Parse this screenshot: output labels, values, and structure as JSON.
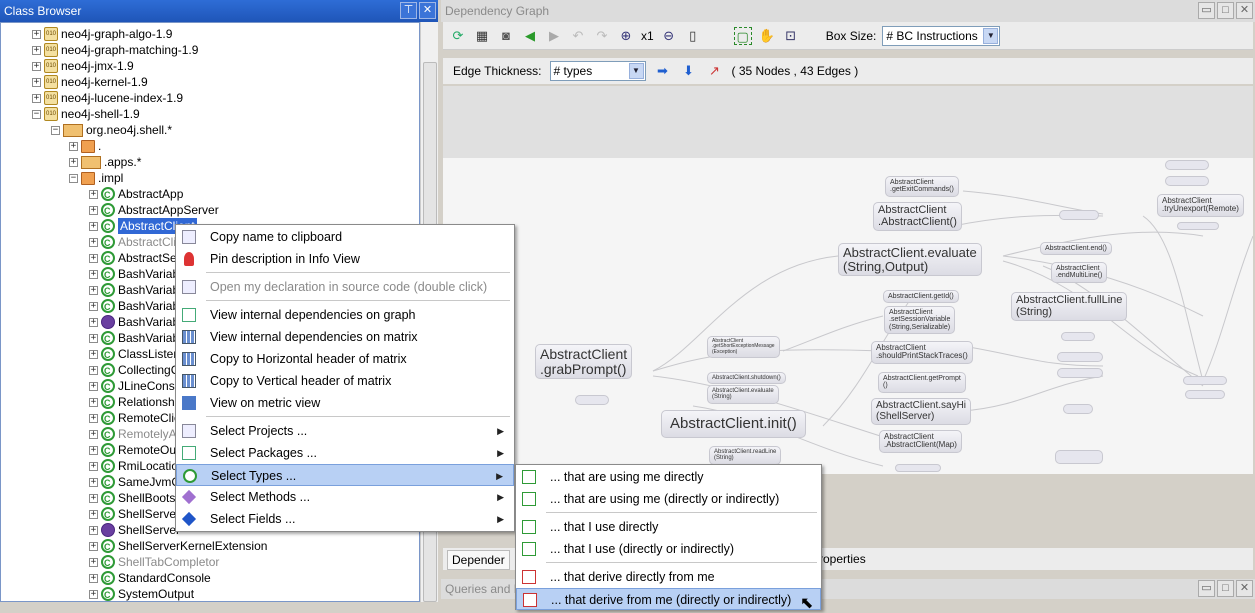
{
  "class_browser": {
    "title": "Class Browser",
    "tree": [
      {
        "label": "neo4j-graph-algo-1.9",
        "kind": "jar",
        "depth": 0
      },
      {
        "label": "neo4j-graph-matching-1.9",
        "kind": "jar",
        "depth": 0
      },
      {
        "label": "neo4j-jmx-1.9",
        "kind": "jar",
        "depth": 0
      },
      {
        "label": "neo4j-kernel-1.9",
        "kind": "jar",
        "depth": 0
      },
      {
        "label": "neo4j-lucene-index-1.9",
        "kind": "jar",
        "depth": 0
      },
      {
        "label": "neo4j-shell-1.9",
        "kind": "jar",
        "depth": 0
      },
      {
        "label": "org.neo4j.shell.*",
        "kind": "pkgmulti",
        "depth": 1
      },
      {
        "label": ".",
        "kind": "pkg",
        "depth": 2
      },
      {
        "label": ".apps.*",
        "kind": "pkgmulti",
        "depth": 2
      },
      {
        "label": ".impl",
        "kind": "pkg",
        "depth": 2
      },
      {
        "label": "AbstractApp",
        "kind": "class",
        "depth": 3
      },
      {
        "label": "AbstractAppServer",
        "kind": "class",
        "depth": 3
      },
      {
        "label": "AbstractClient",
        "kind": "class",
        "depth": 3,
        "selected": true
      },
      {
        "label": "AbstractCli",
        "kind": "class",
        "depth": 3,
        "gray": true
      },
      {
        "label": "AbstractSe",
        "kind": "class",
        "depth": 3
      },
      {
        "label": "BashVariab",
        "kind": "class",
        "depth": 3
      },
      {
        "label": "BashVariab",
        "kind": "class",
        "depth": 3
      },
      {
        "label": "BashVariab",
        "kind": "class",
        "depth": 3
      },
      {
        "label": "BashVariab",
        "kind": "iface",
        "depth": 3
      },
      {
        "label": "BashVariab",
        "kind": "class",
        "depth": 3
      },
      {
        "label": "ClassLister",
        "kind": "class",
        "depth": 3
      },
      {
        "label": "CollectingC",
        "kind": "class",
        "depth": 3
      },
      {
        "label": "JLineConso",
        "kind": "class",
        "depth": 3
      },
      {
        "label": "Relationshi",
        "kind": "class",
        "depth": 3
      },
      {
        "label": "RemoteClie",
        "kind": "class",
        "depth": 3
      },
      {
        "label": "RemotelyA",
        "kind": "class",
        "depth": 3,
        "gray": true
      },
      {
        "label": "RemoteOut",
        "kind": "class",
        "depth": 3
      },
      {
        "label": "RmiLocatio",
        "kind": "class",
        "depth": 3
      },
      {
        "label": "SameJvmC",
        "kind": "class",
        "depth": 3
      },
      {
        "label": "ShellBoots",
        "kind": "class",
        "depth": 3
      },
      {
        "label": "ShellServe",
        "kind": "class",
        "depth": 3
      },
      {
        "label": "ShellServer",
        "kind": "iface",
        "depth": 3
      },
      {
        "label": "ShellServerKernelExtension",
        "kind": "class",
        "depth": 3
      },
      {
        "label": "ShellTabCompletor",
        "kind": "class",
        "depth": 3,
        "gray": true
      },
      {
        "label": "StandardConsole",
        "kind": "class",
        "depth": 3
      },
      {
        "label": "SystemOutput",
        "kind": "class",
        "depth": 3
      }
    ]
  },
  "dependency_graph": {
    "title": "Dependency Graph",
    "zoom_label": "x1",
    "box_size_label": "Box Size:",
    "box_size_value": "# BC Instructions",
    "edge_thickness_label": "Edge Thickness:",
    "edge_thickness_value": "# types",
    "stats": "( 35 Nodes  ,  43 Edges )",
    "tab_left": "Depender",
    "tab_right": "roperties",
    "nodes": {
      "getExitCommands": "AbstractClient\n.getExitCommands()",
      "abstractClientCtor": "AbstractClient\n.AbstractClient()",
      "evaluate": "AbstractClient.evaluate\n(String,Output)",
      "clientEnd": "AbstractClient.end()",
      "endMultiLine": "AbstractClient\n.endMultiLine()",
      "fullLine": "AbstractClient.fullLine\n(String)",
      "getId": "AbstractClient.getId()",
      "setSessionVariable": "AbstractClient\n.setSessionVariable\n(String,Serializable)",
      "shouldPrintStackTraces": "AbstractClient\n.shouldPrintStackTraces()",
      "getPrompt": "AbstractClient.getPrompt\n()",
      "sayHi": "AbstractClient.sayHi\n(ShellServer)",
      "abstractClientMap": "AbstractClient\n.AbstractClient(Map)",
      "tryUnexport": "AbstractClient\n.tryUnexport(Remote)",
      "grabPrompt": "AbstractClient\n.grabPrompt()",
      "init": "AbstractClient.init()",
      "getShortExceptionMessage": "AbstractClient\n.getShortExceptionMessage\n(Exception)",
      "shutdown": "AbstractClient.shutdown()",
      "evaluateString": "AbstractClient.evaluate\n(String)",
      "readLine": "AbstractClient.readLine\n(String)"
    }
  },
  "queries_panel": {
    "title": "Queries and Re"
  },
  "context_menu": {
    "items": [
      {
        "label": "Copy name to clipboard",
        "icon": "clipboard-icon"
      },
      {
        "label": "Pin description in Info View",
        "icon": "pin-icon"
      },
      {
        "label": "Open my declaration in source code (double click)",
        "icon": "document-icon",
        "disabled": true
      },
      {
        "label": "View internal dependencies on graph",
        "icon": "graph-icon"
      },
      {
        "label": "View internal dependencies on matrix",
        "icon": "matrix-icon"
      },
      {
        "label": "Copy to Horizontal header of matrix",
        "icon": "matrix-horizontal-icon"
      },
      {
        "label": "Copy to Vertical header of matrix",
        "icon": "matrix-vertical-icon"
      },
      {
        "label": "View on metric view",
        "icon": "metric-view-icon"
      },
      {
        "label": "Select Projects ...",
        "icon": "project-icon"
      },
      {
        "label": "Select Packages ...",
        "icon": "package-icon"
      },
      {
        "label": "Select Types ...",
        "icon": "type-icon"
      },
      {
        "label": "Select Methods ...",
        "icon": "method-icon"
      },
      {
        "label": "Select Fields ...",
        "icon": "field-icon"
      }
    ]
  },
  "submenu": {
    "items": [
      {
        "label": "... that are using me directly",
        "icon": "using-direct-icon"
      },
      {
        "label": "... that are using me (directly or indirectly)",
        "icon": "using-indirect-icon"
      },
      {
        "label": "... that I use directly",
        "icon": "use-direct-icon"
      },
      {
        "label": "... that I use (directly or indirectly)",
        "icon": "use-indirect-icon"
      },
      {
        "label": "... that derive directly from me",
        "icon": "derive-direct-icon"
      },
      {
        "label": "... that derive from me (directly or indirectly)",
        "icon": "derive-indirect-icon"
      }
    ]
  }
}
